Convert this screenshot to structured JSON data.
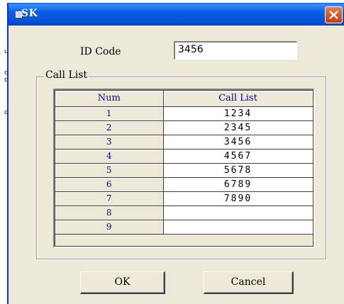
{
  "window": {
    "title": "SK",
    "close_icon": "close-icon"
  },
  "background": {
    "fragments": [
      "u",
      "c",
      "c",
      "c"
    ]
  },
  "form": {
    "id_code_label": "ID Code",
    "id_code_value": "3456"
  },
  "call_list": {
    "group_title": "Call List",
    "columns": [
      "Num",
      "Call List"
    ],
    "rows": [
      {
        "num": "1",
        "value": "1234"
      },
      {
        "num": "2",
        "value": "2345"
      },
      {
        "num": "3",
        "value": "3456"
      },
      {
        "num": "4",
        "value": "4567"
      },
      {
        "num": "5",
        "value": "5678"
      },
      {
        "num": "6",
        "value": "6789"
      },
      {
        "num": "7",
        "value": "7890"
      },
      {
        "num": "8",
        "value": ""
      },
      {
        "num": "9",
        "value": ""
      }
    ]
  },
  "buttons": {
    "ok_label": "OK",
    "cancel_label": "Cancel"
  },
  "colors": {
    "titlebar": "#0a5fe8",
    "dialog_bg": "#ece9d8",
    "num_text": "#0000c0",
    "close_button": "#d65532"
  }
}
